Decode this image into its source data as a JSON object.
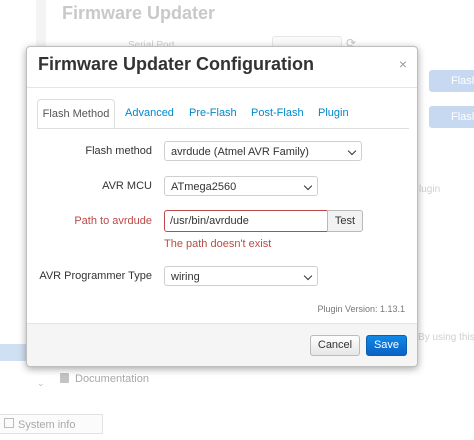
{
  "background": {
    "title": "Firmware Updater",
    "serial_port_label": "Serial Port",
    "flash_button": "Flash",
    "plugin_fragment": "lugin",
    "using_fragment": "By using this",
    "documentation": "Documentation",
    "system_info": "System info"
  },
  "modal": {
    "title": "Firmware Updater Configuration",
    "close_glyph": "×",
    "tabs": [
      {
        "label": "Flash Method",
        "active": true
      },
      {
        "label": "Advanced"
      },
      {
        "label": "Pre-Flash"
      },
      {
        "label": "Post-Flash"
      },
      {
        "label": "Plugin"
      }
    ],
    "form": {
      "flash_method": {
        "label": "Flash method",
        "value": "avrdude (Atmel AVR Family)"
      },
      "avr_mcu": {
        "label": "AVR MCU",
        "value": "ATmega2560"
      },
      "path_to_avrdude": {
        "label": "Path to avrdude",
        "value": "/usr/bin/avrdude",
        "test_label": "Test",
        "error": "The path doesn't exist"
      },
      "programmer_type": {
        "label": "AVR Programmer Type",
        "value": "wiring"
      }
    },
    "plugin_version": "Plugin Version: 1.13.1",
    "footer": {
      "cancel_label": "Cancel",
      "save_label": "Save"
    }
  },
  "colors": {
    "accent": "#0088cc",
    "error": "#b94a48",
    "primary_button": "#0a62c4"
  }
}
